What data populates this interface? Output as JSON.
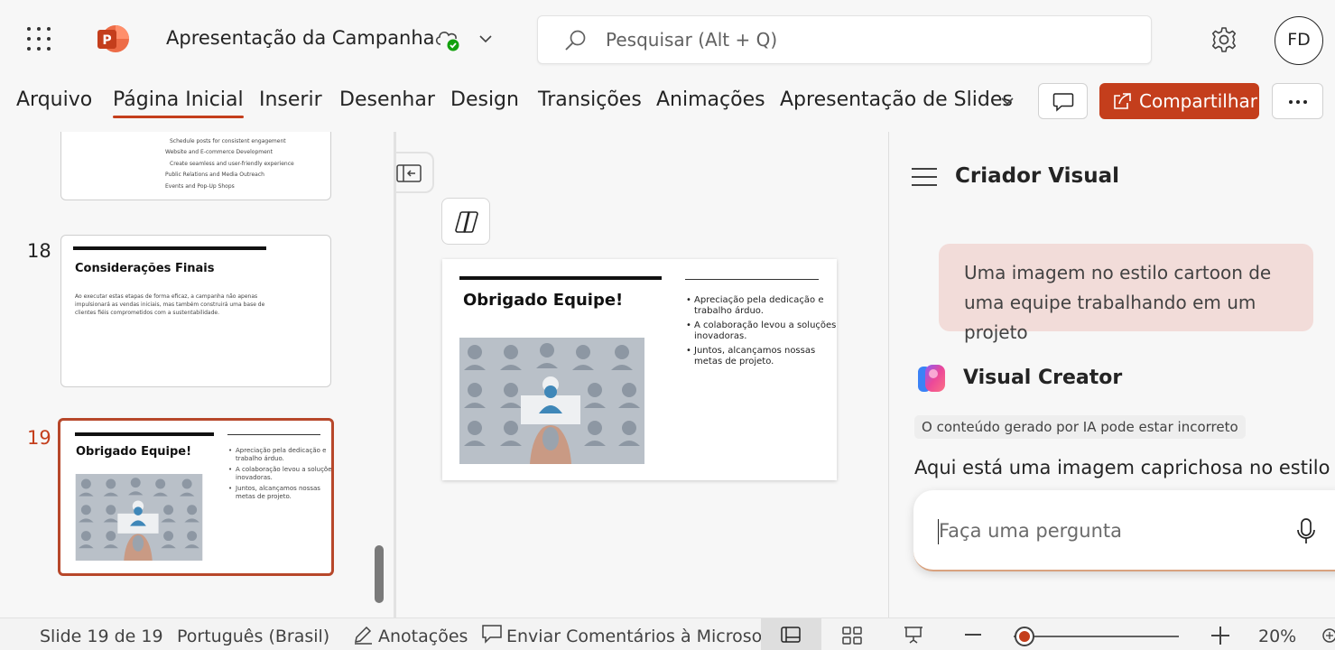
{
  "app": {
    "doc_title": "Apresentação da Campanha",
    "search_placeholder": "Pesquisar (Alt + Q)",
    "avatar_initials": "FD",
    "accent_color": "#c43e1c"
  },
  "ribbon": {
    "tabs": [
      "Arquivo",
      "Página Inicial",
      "Inserir",
      "Desenhar",
      "Design",
      "Transições",
      "Animações",
      "Apresentação de Slides"
    ],
    "active_tab": "Página Inicial",
    "share_label": "Compartilhar"
  },
  "thumbnails": {
    "prev_slide_lines": [
      "Schedule posts for consistent engagement",
      "Website and E-commerce Development",
      "Create seamless and user-friendly experience",
      "Public Relations and Media Outreach",
      "Events and Pop-Up Shops"
    ],
    "slides": [
      {
        "number": "18",
        "title": "Considerações Finais",
        "body": [
          "Ao executar estas etapas de forma eficaz, a campanha não apenas",
          "impulsionará as vendas iniciais, mas também construirá uma base de",
          "clientes fiéis comprometidos com a sustentabilidade."
        ]
      },
      {
        "number": "19",
        "title": "Obrigado Equipe!",
        "bullets": [
          [
            "Apreciação pela dedicação e",
            "trabalho árduo."
          ],
          [
            "A colaboração levou a soluções",
            "inovadoras."
          ],
          [
            "Juntos, alcançamos nossas",
            "metas de projeto."
          ]
        ]
      }
    ]
  },
  "main_slide": {
    "title": "Obrigado Equipe!",
    "bullets": [
      [
        "Apreciação pela dedicação e",
        "trabalho árduo."
      ],
      [
        "A colaboração levou a soluções",
        "inovadoras."
      ],
      [
        "Juntos, alcançamos nossas",
        "metas de projeto."
      ]
    ]
  },
  "copilot_panel": {
    "title": "Criador Visual",
    "user_prompt": "Uma imagem no estilo cartoon de uma equipe trabalhando em um projeto",
    "assistant_name": "Visual Creator",
    "disclaimer": "O conteúdo gerado por IA pode estar incorreto",
    "reply_text": "Aqui está uma imagem caprichosa no estilo car",
    "input_placeholder": "Faça uma pergunta"
  },
  "statusbar": {
    "slide_position": "Slide 19 de 19",
    "language": "Português (Brasil)",
    "notes": "Anotações",
    "feedback": "Enviar Comentários à Microsoft",
    "zoom": "20%"
  }
}
